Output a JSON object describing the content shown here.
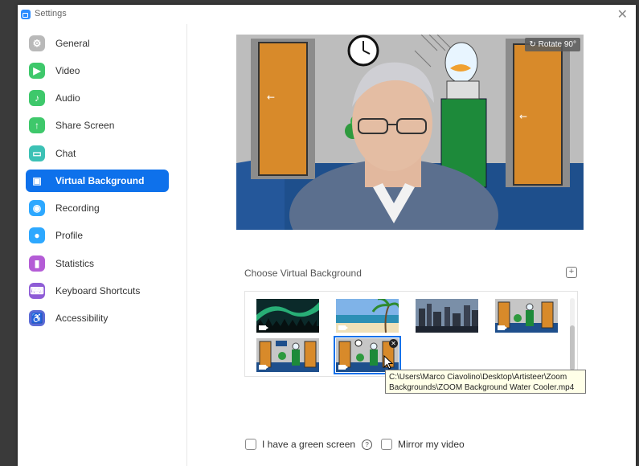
{
  "window": {
    "title": "Settings",
    "close_glyph": "✕"
  },
  "sidebar": {
    "items": [
      {
        "label": "General",
        "icon": "gear-icon",
        "glyph": "⚙",
        "color": "#b9b9b9"
      },
      {
        "label": "Video",
        "icon": "video-icon",
        "glyph": "▶",
        "color": "#3ec86b"
      },
      {
        "label": "Audio",
        "icon": "headphones-icon",
        "glyph": "♪",
        "color": "#3ec86b"
      },
      {
        "label": "Share Screen",
        "icon": "share-screen-icon",
        "glyph": "↑",
        "color": "#3ec86b"
      },
      {
        "label": "Chat",
        "icon": "chat-icon",
        "glyph": "▭",
        "color": "#3cc1b5"
      },
      {
        "label": "Virtual Background",
        "icon": "virtual-background-icon",
        "glyph": "▣",
        "color": "#0e71eb",
        "active": true
      },
      {
        "label": "Recording",
        "icon": "recording-icon",
        "glyph": "◉",
        "color": "#2da8ff"
      },
      {
        "label": "Profile",
        "icon": "profile-icon",
        "glyph": "●",
        "color": "#2da8ff"
      },
      {
        "label": "Statistics",
        "icon": "statistics-icon",
        "glyph": "▮",
        "color": "#b45cd6"
      },
      {
        "label": "Keyboard Shortcuts",
        "icon": "keyboard-icon",
        "glyph": "⌨",
        "color": "#8e5cd6"
      },
      {
        "label": "Accessibility",
        "icon": "accessibility-icon",
        "glyph": "♿",
        "color": "#5c6bd6"
      }
    ]
  },
  "preview": {
    "rotate_label": "Rotate 90°",
    "rotate_glyph": "↻"
  },
  "backgrounds": {
    "heading": "Choose Virtual Background",
    "add_glyph": "+",
    "items": [
      {
        "name": "aurora",
        "has_video": true
      },
      {
        "name": "beach",
        "has_video": true
      },
      {
        "name": "city-skyline",
        "has_video": false
      },
      {
        "name": "office-doors",
        "has_video": true
      },
      {
        "name": "office-water-cooler-sign",
        "has_video": true
      },
      {
        "name": "water-cooler-video",
        "has_video": true,
        "selected": true
      }
    ],
    "tooltip_line1": "C:\\Users\\Marco Ciavolino\\Desktop\\Artisteer\\Zoom",
    "tooltip_line2": "Backgrounds\\ZOOM Background Water Cooler.mp4"
  },
  "options": {
    "green_screen_label": "I have a green screen",
    "green_screen_checked": false,
    "help_glyph": "?",
    "mirror_label": "Mirror my video",
    "mirror_checked": false
  },
  "colors": {
    "accent": "#0e71eb",
    "door": "#d88a2a",
    "floor": "#1e4f8c",
    "wall": "#b8b8b8"
  }
}
